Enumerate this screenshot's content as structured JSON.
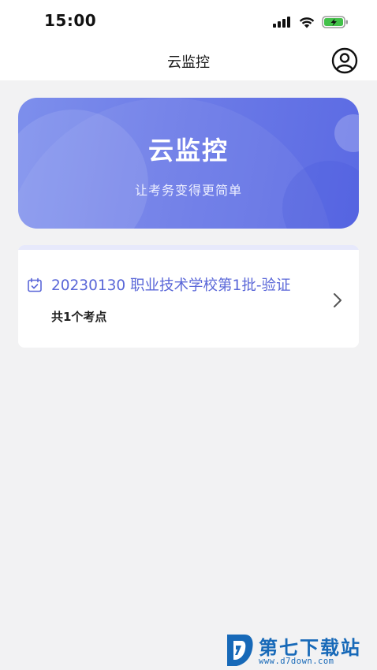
{
  "status_bar": {
    "time": "15:00"
  },
  "nav": {
    "title": "云监控",
    "profile_icon": "user-circle-icon"
  },
  "hero": {
    "title": "云监控",
    "subtitle": "让考务变得更简单",
    "gradient_start": "#7d8fec",
    "gradient_end": "#5b6ae3"
  },
  "exam_list": [
    {
      "title": "20230130 职业技术学校第1批-验证",
      "count": "共1个考点",
      "icon": "calendar-icon"
    }
  ],
  "watermark": {
    "name": "第七下载站",
    "url": "www.d7down.com"
  },
  "colors": {
    "accent": "#5a67d8",
    "background": "#f2f2f3",
    "watermark": "#1769b8"
  }
}
